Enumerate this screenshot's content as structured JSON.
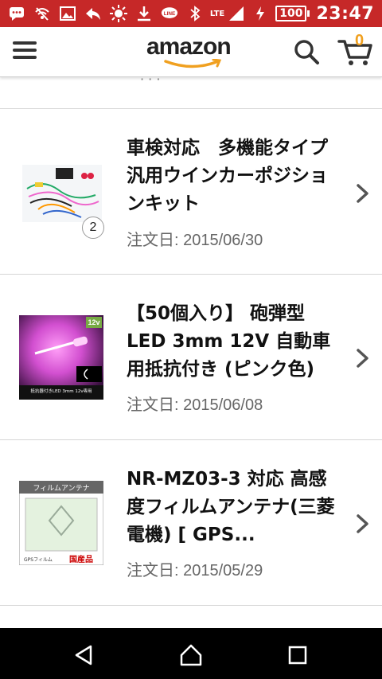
{
  "status_bar": {
    "time": "23:47",
    "network": "LTE",
    "battery": "100",
    "icons": [
      "message-icon",
      "wifi-off-icon",
      "image-icon",
      "reply-icon",
      "brightness-icon",
      "download-icon",
      "line-app-icon",
      "bluetooth-icon",
      "signal-icon",
      "charging-icon"
    ]
  },
  "header": {
    "logo": "amazon",
    "cart_count": "0"
  },
  "orders": [
    {
      "title": "車検対応　多機能タイプ汎用ウインカーポジションキット",
      "date": "注文日: 2015/06/30",
      "quantity": "2"
    },
    {
      "title": "【50個入り】 砲弾型LED 3mm 12V 自動車用抵抗付き (ピンク色)",
      "date": "注文日: 2015/06/08",
      "thumb_badge": "12v",
      "thumb_caption": "抵抗器付きLED 3mm 12v専用"
    },
    {
      "title": "NR-MZ03-3 対応 高感度フィルムアンテナ(三菱電機) [ GPS...",
      "date": "注文日: 2015/05/29",
      "thumb_label": "フィルムアンテナ",
      "thumb_footer_left": "GPSフィルム",
      "thumb_footer_right": "国産品"
    }
  ],
  "colors": {
    "status_bar": "#c62828",
    "cart_count": "#f0a020",
    "nav_bar": "#000000"
  }
}
